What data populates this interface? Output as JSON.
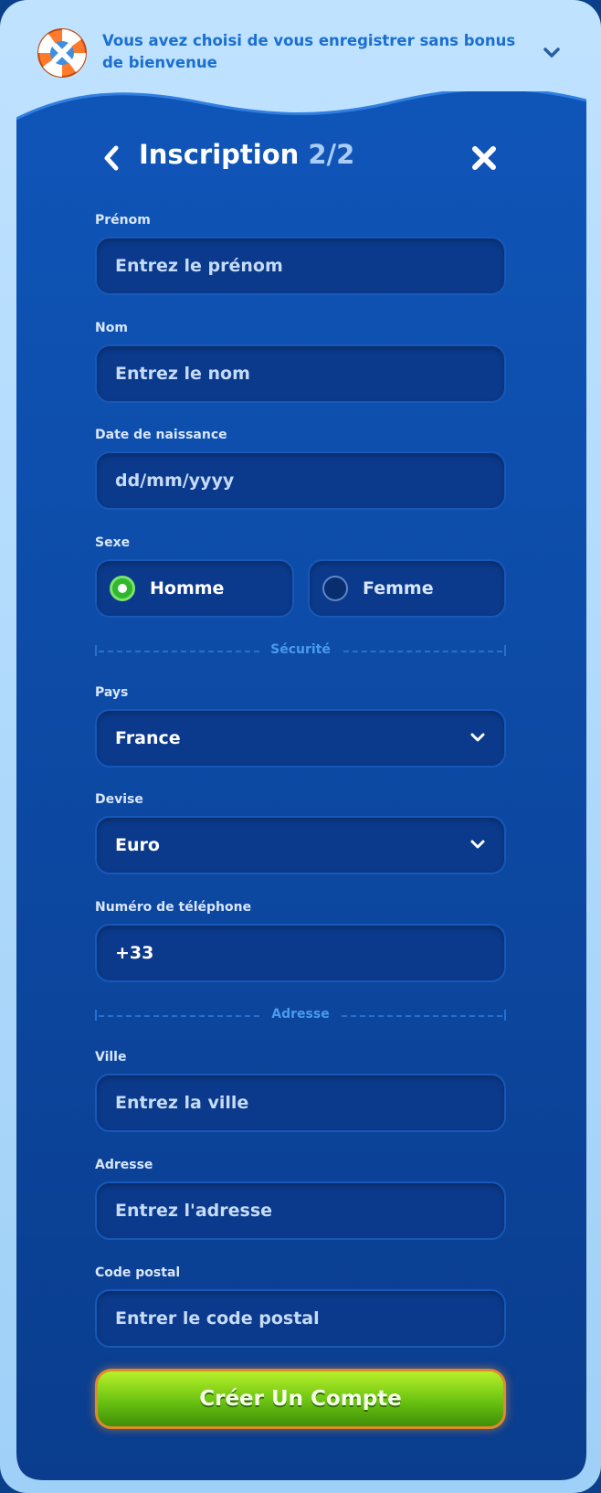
{
  "colors": {
    "panel": "#0f4fb0",
    "field_bg": "#0b3a8c",
    "field_border": "#1758b8",
    "accent_green": "#6ac211",
    "cta_border": "#e08a2d",
    "header_text": "#1a6fd0"
  },
  "bonus": {
    "text": "Vous avez choisi de vous enregistrer sans bonus de bienvenue",
    "icon": "lifebuoy-icon",
    "toggle_icon": "chevron-down-icon"
  },
  "header": {
    "title": "Inscription",
    "step": "2/2",
    "back_icon": "chevron-left-icon",
    "close_icon": "close-icon"
  },
  "fields": {
    "first_name": {
      "label": "Prénom",
      "placeholder": "Entrez le prénom"
    },
    "last_name": {
      "label": "Nom",
      "placeholder": "Entrez le nom"
    },
    "birth_date": {
      "label": "Date de naissance",
      "placeholder": "dd/mm/yyyy"
    },
    "gender": {
      "label": "Sexe",
      "options": [
        {
          "label": "Homme",
          "selected": true
        },
        {
          "label": "Femme",
          "selected": false
        }
      ]
    },
    "country": {
      "label": "Pays",
      "value": "France"
    },
    "currency": {
      "label": "Devise",
      "value": "Euro"
    },
    "phone": {
      "label": "Numéro de téléphone",
      "value": "+33"
    },
    "city": {
      "label": "Ville",
      "placeholder": "Entrez la ville"
    },
    "address": {
      "label": "Adresse",
      "placeholder": "Entrez l'adresse"
    },
    "postal_code": {
      "label": "Code postal",
      "placeholder": "Entrer le code postal"
    }
  },
  "sections": {
    "security": "Sécurité",
    "address": "Adresse"
  },
  "submit": {
    "label": "Créer Un Compte"
  }
}
